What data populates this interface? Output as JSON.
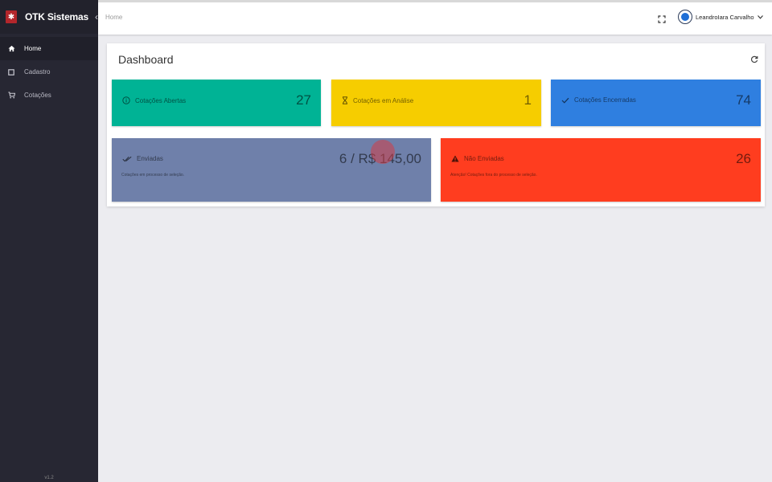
{
  "sidebar": {
    "brand": "OTK Sistemas",
    "toggle_icon": "chevron-left-icon",
    "items": [
      {
        "label": "Home",
        "icon": "home-icon",
        "active": true
      },
      {
        "label": "Cadastro",
        "icon": "square-icon",
        "active": false
      },
      {
        "label": "Cotações",
        "icon": "cart-icon",
        "active": false
      }
    ],
    "version": "v1.2"
  },
  "topbar": {
    "breadcrumb": "Home",
    "user_name": "LeandroIara Carvalho"
  },
  "dashboard": {
    "title": "Dashboard",
    "tiles": [
      {
        "label": "Cotações Abertas",
        "value": "27",
        "color": "#00b395",
        "icon": "info-icon"
      },
      {
        "label": "Cotações em Análise",
        "value": "1",
        "color": "#f6cd00",
        "icon": "hourglass-icon"
      },
      {
        "label": "Cotações Encerradas",
        "value": "74",
        "color": "#2f7fe0",
        "icon": "check-icon"
      },
      {
        "label": "Enviadas",
        "value": "6 / R$ 145,00",
        "sub": "Cotações em processo de seleção.",
        "color": "#6f80aa",
        "icon": "double-check-icon"
      },
      {
        "label": "Não Enviadas",
        "value": "26",
        "sub": "Atenção! Cotações fora do processo de seleção.",
        "color": "#ff3d1f",
        "icon": "warning-icon"
      }
    ]
  }
}
